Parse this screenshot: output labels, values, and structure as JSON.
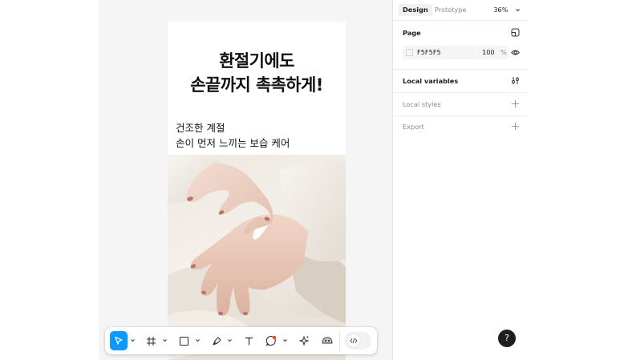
{
  "canvas": {
    "background": "#f5f5f5",
    "frame": {
      "headline_line1": "환절기에도",
      "headline_line2": "손끝까지 촉촉하게!",
      "sub_line1": "건조한 계절",
      "sub_line2": "손이 먼저 느끼는 보습 케어",
      "photo_icon": "hand-cream-photo"
    }
  },
  "toolbar": {
    "tools": [
      "move-icon",
      "frame-icon",
      "rectangle-icon",
      "pen-icon",
      "text-icon",
      "comment-icon",
      "actions-icon",
      "dev-mode-icon"
    ],
    "accent": "#0d99ff"
  },
  "panel": {
    "tabs": {
      "design": "Design",
      "prototype": "Prototype"
    },
    "zoom": "36%",
    "page": {
      "title": "Page",
      "color_hex": "F5F5F5",
      "opacity": "100",
      "percent": "%"
    },
    "local_variables": "Local variables",
    "local_styles": "Local styles",
    "export": "Export"
  },
  "help": "?"
}
